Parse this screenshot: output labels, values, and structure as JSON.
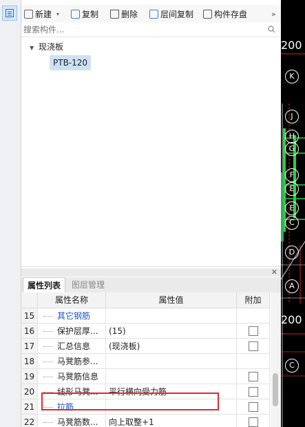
{
  "toolbar": {
    "new_label": "新建",
    "copy_label": "复制",
    "delete_label": "删除",
    "floor_copy_label": "层间复制",
    "save_label": "构件存盘",
    "more_label": "»"
  },
  "search": {
    "placeholder": "搜索构件..."
  },
  "tree": {
    "root": "现浇板",
    "items": [
      "PTB-120"
    ]
  },
  "tabs": [
    "属性列表",
    "图层管理"
  ],
  "grid": {
    "columns": [
      "属性名称",
      "属性值",
      "附加"
    ],
    "rows": [
      {
        "num": "15",
        "name": "其它钢筋",
        "value": "",
        "check": false,
        "category": true
      },
      {
        "num": "16",
        "name": "保护层厚...",
        "value": "(15)",
        "check": true,
        "category": false
      },
      {
        "num": "17",
        "name": "汇总信息",
        "value": "(现浇板)",
        "check": true,
        "category": false
      },
      {
        "num": "18",
        "name": "马凳筋参...",
        "value": "",
        "check": false,
        "category": false
      },
      {
        "num": "19",
        "name": "马凳筋信息",
        "value": "",
        "check": true,
        "category": false
      },
      {
        "num": "20",
        "name": "线形马凳...",
        "value": "平行横向受力筋",
        "check": true,
        "category": false
      },
      {
        "num": "21",
        "name": "拉筋",
        "value": "",
        "check": true,
        "category": true
      },
      {
        "num": "22",
        "name": "马凳筋数...",
        "value": "向上取整+1",
        "check": true,
        "category": false
      }
    ]
  },
  "cad": {
    "labels": [
      "200",
      "K",
      "J",
      "H",
      "G",
      "F",
      "E",
      "E",
      "C",
      "D",
      "A",
      "200",
      "C"
    ]
  },
  "colors": {
    "accent": "#3b7dd8",
    "selection": "#cde1f5",
    "highlight": "#e0282e",
    "category_text": "#1f56c6"
  }
}
